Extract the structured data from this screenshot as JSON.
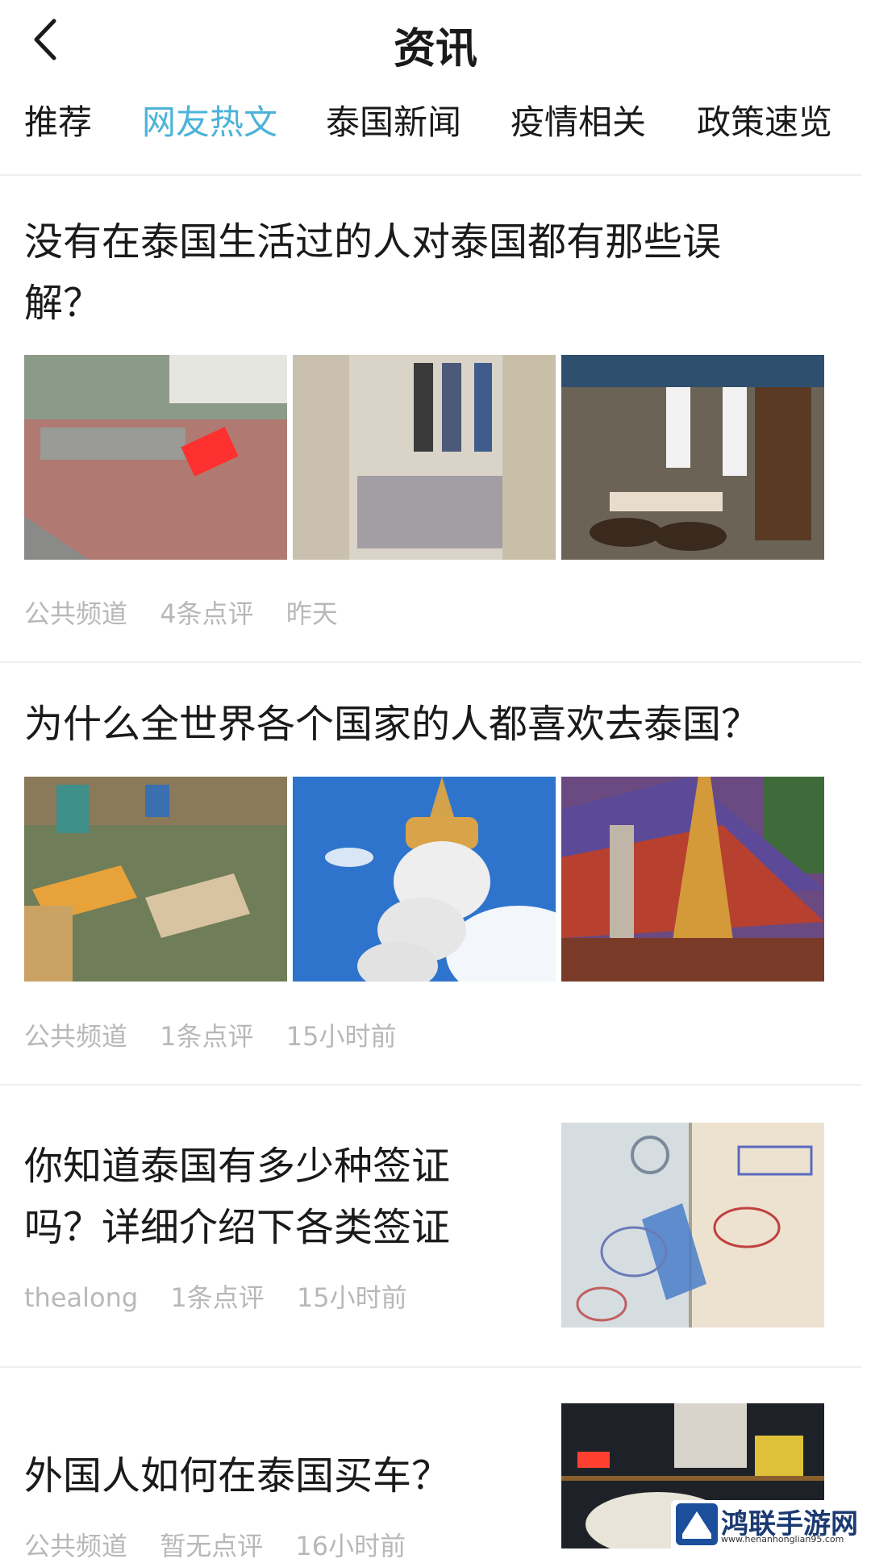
{
  "header": {
    "title": "资讯"
  },
  "tabs": [
    {
      "label": "推荐",
      "active": false
    },
    {
      "label": "网友热文",
      "active": true
    },
    {
      "label": "泰国新闻",
      "active": false
    },
    {
      "label": "疫情相关",
      "active": false
    },
    {
      "label": "政策速览",
      "active": false
    }
  ],
  "articles": [
    {
      "title_line1": "没有在泰国生活过的人对泰国都有那些误",
      "title_line2": "解？",
      "source": "公共频道",
      "comments": "4条点评",
      "time": "昨天"
    },
    {
      "title_line1": "为什么全世界各个国家的人都喜欢去泰国？",
      "source": "公共频道",
      "comments": "1条点评",
      "time": "15小时前"
    },
    {
      "title_line1": "你知道泰国有多少种签证",
      "title_line2": "吗？详细介绍下各类签证",
      "source": "thealong",
      "comments": "1条点评",
      "time": "15小时前"
    },
    {
      "title_line1": "外国人如何在泰国买车？",
      "source": "公共频道",
      "comments": "暂无点评",
      "time": "16小时前"
    }
  ],
  "watermark": {
    "name": "鸿联手游网",
    "url": "www.henanhonglian95.com"
  },
  "colors": {
    "accent": "#4cb3d8",
    "meta": "#b8b8b8",
    "text": "#1a1a1a"
  }
}
